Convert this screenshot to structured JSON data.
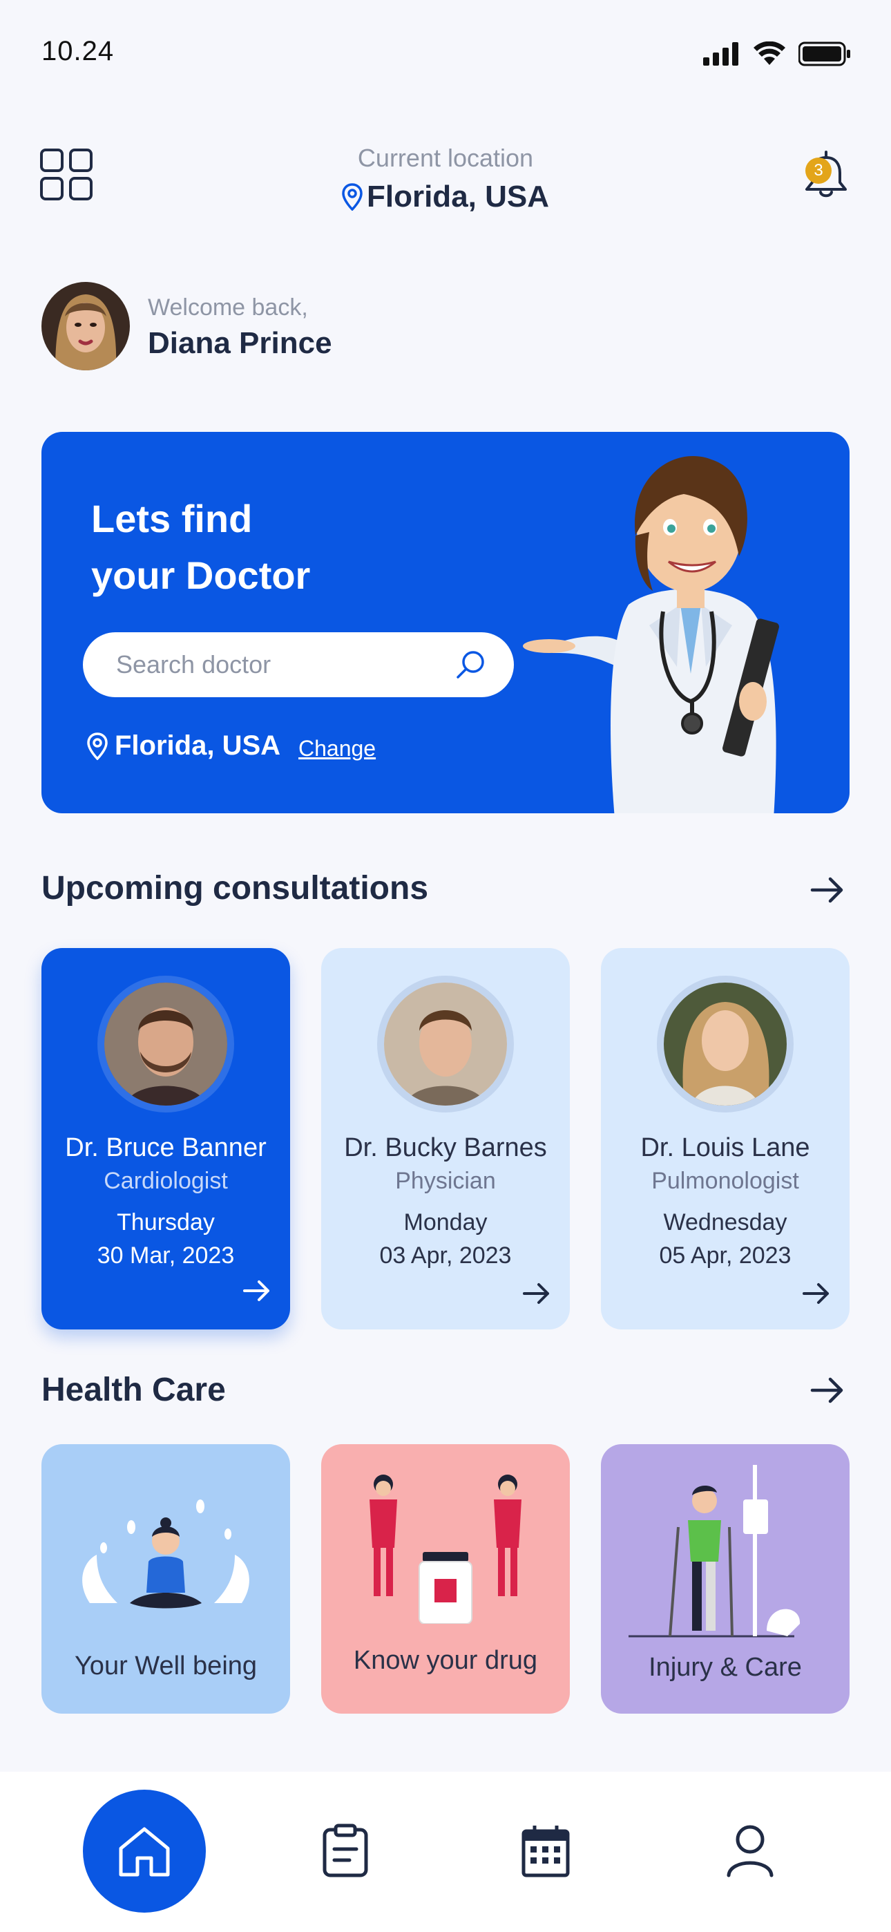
{
  "status_bar": {
    "time": "10.24"
  },
  "header": {
    "location_label": "Current location",
    "location_value": "Florida, USA",
    "notification_count": "3"
  },
  "welcome": {
    "subtitle": "Welcome back,",
    "name": "Diana Prince"
  },
  "hero": {
    "title_line1": "Lets find",
    "title_line2": "your Doctor",
    "search_placeholder": "Search doctor",
    "location": "Florida, USA",
    "change_link": "Change"
  },
  "consultations": {
    "title": "Upcoming consultations",
    "cards": [
      {
        "name": "Dr. Bruce Banner",
        "specialty": "Cardiologist",
        "day": "Thursday",
        "date": "30 Mar, 2023"
      },
      {
        "name": "Dr. Bucky Barnes",
        "specialty": "Physician",
        "day": "Monday",
        "date": "03 Apr, 2023"
      },
      {
        "name": "Dr. Louis Lane",
        "specialty": "Pulmonologist",
        "day": "Wednesday",
        "date": "05 Apr, 2023"
      }
    ]
  },
  "health_care": {
    "title": "Health Care",
    "tiles": [
      {
        "label": "Your Well being",
        "color": "#A9CEF7"
      },
      {
        "label": "Know your drug",
        "color": "#F9AFAF"
      },
      {
        "label": "Injury & Care",
        "color": "#B6A7E6"
      }
    ]
  },
  "bottom_nav": {
    "items": [
      "home-icon",
      "clipboard-icon",
      "calendar-icon",
      "user-icon"
    ],
    "active": "home-icon"
  },
  "colors": {
    "primary": "#0A57E3",
    "text": "#1F2A44",
    "muted": "#8E95A5",
    "badge": "#E3A51A"
  }
}
